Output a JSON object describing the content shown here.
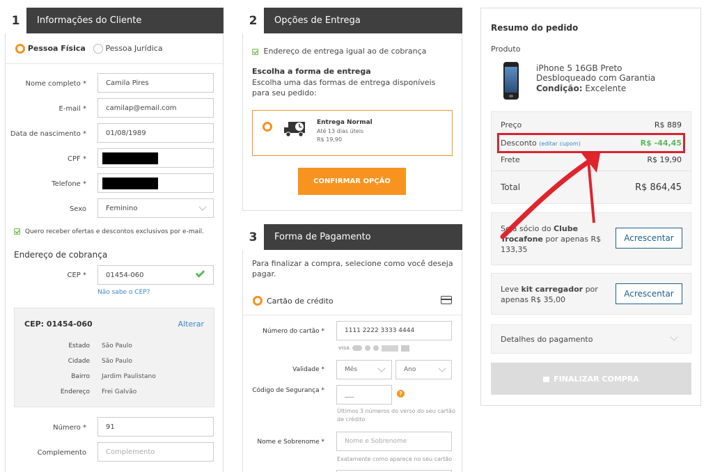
{
  "client": {
    "step": "1",
    "title": "Informações do Cliente",
    "type_options": [
      "Pessoa Física",
      "Pessoa Jurídica"
    ],
    "fields": [
      {
        "label": "Nome completo *",
        "value": "Camila Pires"
      },
      {
        "label": "E-mail *",
        "value": "camilap@email.com"
      },
      {
        "label": "Data de nascimento *",
        "value": "01/08/1989"
      },
      {
        "label": "CPF *",
        "value": ""
      },
      {
        "label": "Telefone *",
        "value": ""
      },
      {
        "label": "Sexo",
        "value": "Feminino"
      }
    ],
    "offers_label": "Quero receber ofertas e descontos exclusivos por e-mail.",
    "billing_title": "Endereço de cobrança",
    "cep_label": "CEP *",
    "cep_value": "01454-060",
    "cep_help": "Não sabe o CEP?",
    "address_box": {
      "title": "CEP: 01454-060",
      "edit": "Alterar",
      "rows": [
        {
          "label": "Estado",
          "value": "São Paulo"
        },
        {
          "label": "Cidade",
          "value": "São Paulo"
        },
        {
          "label": "Bairro",
          "value": "Jardim Paulistano"
        },
        {
          "label": "Endereço",
          "value": "Frei Galvão"
        }
      ]
    },
    "number_label": "Número *",
    "number_value": "91",
    "complement_label": "Complemento",
    "complement_placeholder": "Complemento"
  },
  "delivery": {
    "step": "2",
    "title": "Opções de Entrega",
    "same_address": "Endereço de entrega igual ao de cobrança",
    "choose_title": "Escolha a forma de entrega",
    "choose_desc": "Escolha uma das formas de entrega disponíveis para seu pedido:",
    "option": {
      "name": "Entrega Normal",
      "time": "Até 13 dias úteis",
      "price": "R$ 19,90"
    },
    "confirm": "CONFIRMAR OPÇÃO"
  },
  "payment": {
    "step": "3",
    "title": "Forma de Pagamento",
    "intro": "Para finalizar a compra, selecione como você deseja pagar.",
    "method": "Cartão de crédito",
    "card_label": "Número do cartão *",
    "card_value": "1111 2222 3333 4444",
    "brands": [
      "VISA",
      "",
      "",
      "",
      ""
    ],
    "validity_label": "Validade *",
    "month": "Mês",
    "year": "Ano",
    "cvv_label": "Código de Segurança *",
    "cvv_value": "___",
    "cvv_help": "Últimos 3 números do verso do seu cartão de crédito",
    "name_label": "Nome e Sobrenome *",
    "name_placeholder": "Nome e Sobrenome",
    "name_help": "Exatamente como aparece no seu cartão"
  },
  "summary": {
    "title": "Resumo do pedido",
    "product_label": "Produto",
    "product_line1": "iPhone 5 16GB Preto",
    "product_line2": "Desbloqueado com Garantia",
    "condition_label": "Condição:",
    "condition_value": "Excelente",
    "price_label": "Preço",
    "price": "R$ 889",
    "discount_label": "Desconto",
    "discount_edit": "(editar cupom)",
    "discount": "R$ -44,45",
    "shipping_label": "Frete",
    "shipping": "R$ 19,90",
    "total_label": "Total",
    "total": "R$ 864,45",
    "club_text_a": "Seja sócio do ",
    "club_text_b": "Clube Trocafone",
    "club_text_c": " por apenas R$ 133,35",
    "club_button": "Acrescentar",
    "kit_text_a": "Leve ",
    "kit_text_b": "kit carregador",
    "kit_text_c": " por apenas R$ 35,00",
    "kit_button": "Acrescentar",
    "payment_details": "Detalhes do pagamento",
    "finish": "FINALIZAR COMPRA"
  },
  "colors": {
    "accent": "#f7931e",
    "header": "#3f3f3f",
    "highlight": "#d9232f",
    "link": "#3a87c8",
    "discount": "#5cb85c"
  }
}
